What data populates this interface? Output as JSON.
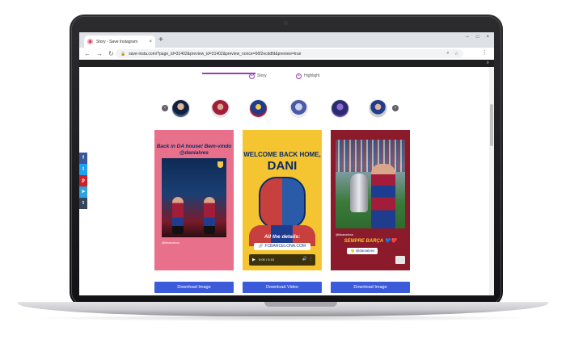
{
  "browser": {
    "tab_title": "Story - Save Instagram",
    "tab_close": "×",
    "new_tab": "+",
    "window_buttons": {
      "minimize": "–",
      "maximize": "□",
      "close": "×"
    },
    "url": "save-insta.com/?page_id=31402&preview_id=31402&preview_nonce=66f2ecddfd&preview=true",
    "nav": {
      "back": "←",
      "forward": "→",
      "reload": "↻"
    },
    "site_search_icon": "🔍"
  },
  "page": {
    "tabs": [
      {
        "label": "Story",
        "icon": "plus-circle-icon"
      },
      {
        "label": "Highlight",
        "icon": "plus-circle-icon",
        "active": true
      }
    ],
    "arrow_left": "‹",
    "arrow_right": "›",
    "share": [
      "f",
      "t",
      "p",
      "➤",
      "t"
    ],
    "cards": [
      {
        "title": "Back in DA house! Bem-vindo @danialves",
        "handle": "@fcbarcelona",
        "button": "Download Image"
      },
      {
        "title_line1": "WELCOME BACK HOME,",
        "title_line2": "DANI",
        "details": "All the details:",
        "link": "🔗 FCBARCELONA.COM",
        "video_time": "0:00 / 0:15",
        "button": "Download Video"
      },
      {
        "handle": "@fcbarcelona",
        "caption": "SEMPRE BARÇA 💙❤️",
        "tag": "👋 @danialves",
        "button": "Download Image"
      }
    ]
  },
  "colors": {
    "accent_purple": "#9b3fb0",
    "download_button": "#3b5bdb",
    "card1_bg": "#e8708a",
    "card2_bg": "#f4c531",
    "card3_bg": "#8b1a2a"
  }
}
